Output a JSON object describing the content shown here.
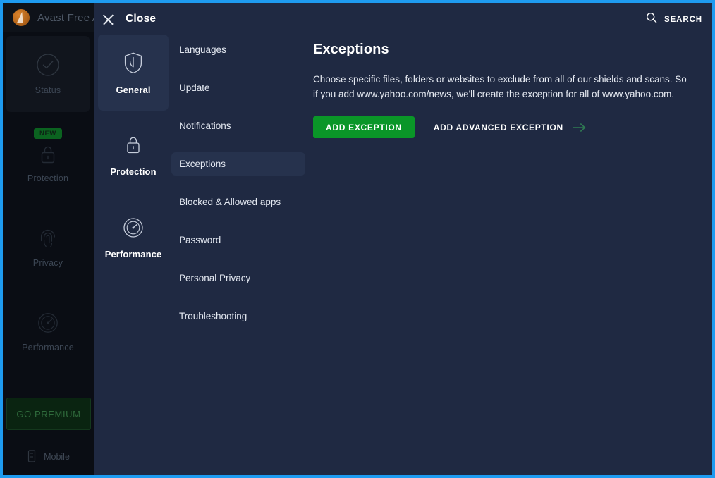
{
  "window": {
    "border_color": "#1e9bf0",
    "title": "Avast Free A",
    "logo_icon": "avast-logo-icon"
  },
  "left_nav": {
    "items": [
      {
        "label": "Status",
        "icon": "check-circle-icon",
        "active": true
      },
      {
        "label": "Protection",
        "icon": "lock-icon",
        "badge": "NEW",
        "active": false
      },
      {
        "label": "Privacy",
        "icon": "fingerprint-icon",
        "active": false
      },
      {
        "label": "Performance",
        "icon": "speedometer-icon",
        "active": false
      }
    ],
    "go_premium_label": "GO PREMIUM",
    "mobile_label": "Mobile",
    "mobile_icon": "mobile-phone-icon"
  },
  "overlay": {
    "close_label": "Close",
    "close_icon": "close-icon",
    "search_label": "SEARCH",
    "search_icon": "search-icon",
    "categories": [
      {
        "label": "General",
        "icon": "shield-icon",
        "active": true
      },
      {
        "label": "Protection",
        "icon": "lock-icon",
        "active": false
      },
      {
        "label": "Performance",
        "icon": "speedometer-icon",
        "active": false
      }
    ],
    "submenu": [
      {
        "label": "Languages",
        "active": false
      },
      {
        "label": "Update",
        "active": false
      },
      {
        "label": "Notifications",
        "active": false
      },
      {
        "label": "Exceptions",
        "active": true
      },
      {
        "label": "Blocked & Allowed apps",
        "active": false
      },
      {
        "label": "Password",
        "active": false
      },
      {
        "label": "Personal Privacy",
        "active": false
      },
      {
        "label": "Troubleshooting",
        "active": false
      }
    ],
    "content": {
      "title": "Exceptions",
      "description": "Choose specific files, folders or websites to exclude from all of our shields and scans. So if you add www.yahoo.com/news, we'll create the exception for all of www.yahoo.com.",
      "primary_button": "ADD EXCEPTION",
      "secondary_button": "ADD ADVANCED EXCEPTION",
      "secondary_icon": "arrow-right-icon",
      "primary_button_color": "#0a9628"
    }
  }
}
